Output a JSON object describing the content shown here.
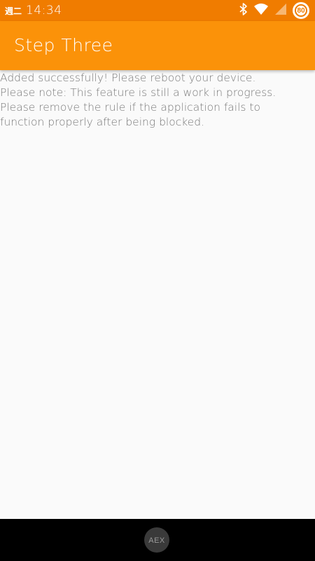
{
  "status_bar": {
    "weekday": "週二",
    "time": "14:34",
    "battery_level": "80",
    "icons": [
      "bluetooth-icon",
      "wifi-icon",
      "cell-signal-icon",
      "battery-icon"
    ]
  },
  "app_bar": {
    "title": "Step Three",
    "color": "#fb9209"
  },
  "content": {
    "lines": [
      "Added successfully! Please reboot your device.",
      "Please note: This feature is still a work in progress.",
      "Please remove the rule if the application fails to",
      "function properly after being blocked."
    ]
  },
  "nav_bar": {
    "home_logo": "AEX"
  },
  "colors": {
    "status_bar": "#f07c00",
    "app_bar": "#fb9209",
    "background": "#fafafa",
    "text": "#7a7a7a"
  }
}
